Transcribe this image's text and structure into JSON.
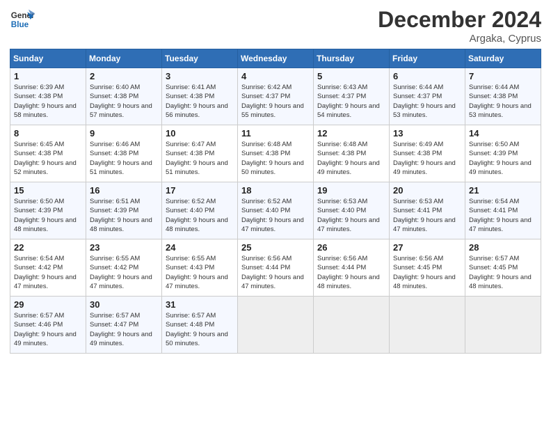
{
  "header": {
    "logo_line1": "General",
    "logo_line2": "Blue",
    "month": "December 2024",
    "location": "Argaka, Cyprus"
  },
  "weekdays": [
    "Sunday",
    "Monday",
    "Tuesday",
    "Wednesday",
    "Thursday",
    "Friday",
    "Saturday"
  ],
  "weeks": [
    [
      {
        "day": "1",
        "sunrise": "6:39 AM",
        "sunset": "4:38 PM",
        "daylight": "9 hours and 58 minutes."
      },
      {
        "day": "2",
        "sunrise": "6:40 AM",
        "sunset": "4:38 PM",
        "daylight": "9 hours and 57 minutes."
      },
      {
        "day": "3",
        "sunrise": "6:41 AM",
        "sunset": "4:38 PM",
        "daylight": "9 hours and 56 minutes."
      },
      {
        "day": "4",
        "sunrise": "6:42 AM",
        "sunset": "4:37 PM",
        "daylight": "9 hours and 55 minutes."
      },
      {
        "day": "5",
        "sunrise": "6:43 AM",
        "sunset": "4:37 PM",
        "daylight": "9 hours and 54 minutes."
      },
      {
        "day": "6",
        "sunrise": "6:44 AM",
        "sunset": "4:37 PM",
        "daylight": "9 hours and 53 minutes."
      },
      {
        "day": "7",
        "sunrise": "6:44 AM",
        "sunset": "4:38 PM",
        "daylight": "9 hours and 53 minutes."
      }
    ],
    [
      {
        "day": "8",
        "sunrise": "6:45 AM",
        "sunset": "4:38 PM",
        "daylight": "9 hours and 52 minutes."
      },
      {
        "day": "9",
        "sunrise": "6:46 AM",
        "sunset": "4:38 PM",
        "daylight": "9 hours and 51 minutes."
      },
      {
        "day": "10",
        "sunrise": "6:47 AM",
        "sunset": "4:38 PM",
        "daylight": "9 hours and 51 minutes."
      },
      {
        "day": "11",
        "sunrise": "6:48 AM",
        "sunset": "4:38 PM",
        "daylight": "9 hours and 50 minutes."
      },
      {
        "day": "12",
        "sunrise": "6:48 AM",
        "sunset": "4:38 PM",
        "daylight": "9 hours and 49 minutes."
      },
      {
        "day": "13",
        "sunrise": "6:49 AM",
        "sunset": "4:38 PM",
        "daylight": "9 hours and 49 minutes."
      },
      {
        "day": "14",
        "sunrise": "6:50 AM",
        "sunset": "4:39 PM",
        "daylight": "9 hours and 49 minutes."
      }
    ],
    [
      {
        "day": "15",
        "sunrise": "6:50 AM",
        "sunset": "4:39 PM",
        "daylight": "9 hours and 48 minutes."
      },
      {
        "day": "16",
        "sunrise": "6:51 AM",
        "sunset": "4:39 PM",
        "daylight": "9 hours and 48 minutes."
      },
      {
        "day": "17",
        "sunrise": "6:52 AM",
        "sunset": "4:40 PM",
        "daylight": "9 hours and 48 minutes."
      },
      {
        "day": "18",
        "sunrise": "6:52 AM",
        "sunset": "4:40 PM",
        "daylight": "9 hours and 47 minutes."
      },
      {
        "day": "19",
        "sunrise": "6:53 AM",
        "sunset": "4:40 PM",
        "daylight": "9 hours and 47 minutes."
      },
      {
        "day": "20",
        "sunrise": "6:53 AM",
        "sunset": "4:41 PM",
        "daylight": "9 hours and 47 minutes."
      },
      {
        "day": "21",
        "sunrise": "6:54 AM",
        "sunset": "4:41 PM",
        "daylight": "9 hours and 47 minutes."
      }
    ],
    [
      {
        "day": "22",
        "sunrise": "6:54 AM",
        "sunset": "4:42 PM",
        "daylight": "9 hours and 47 minutes."
      },
      {
        "day": "23",
        "sunrise": "6:55 AM",
        "sunset": "4:42 PM",
        "daylight": "9 hours and 47 minutes."
      },
      {
        "day": "24",
        "sunrise": "6:55 AM",
        "sunset": "4:43 PM",
        "daylight": "9 hours and 47 minutes."
      },
      {
        "day": "25",
        "sunrise": "6:56 AM",
        "sunset": "4:44 PM",
        "daylight": "9 hours and 47 minutes."
      },
      {
        "day": "26",
        "sunrise": "6:56 AM",
        "sunset": "4:44 PM",
        "daylight": "9 hours and 48 minutes."
      },
      {
        "day": "27",
        "sunrise": "6:56 AM",
        "sunset": "4:45 PM",
        "daylight": "9 hours and 48 minutes."
      },
      {
        "day": "28",
        "sunrise": "6:57 AM",
        "sunset": "4:45 PM",
        "daylight": "9 hours and 48 minutes."
      }
    ],
    [
      {
        "day": "29",
        "sunrise": "6:57 AM",
        "sunset": "4:46 PM",
        "daylight": "9 hours and 49 minutes."
      },
      {
        "day": "30",
        "sunrise": "6:57 AM",
        "sunset": "4:47 PM",
        "daylight": "9 hours and 49 minutes."
      },
      {
        "day": "31",
        "sunrise": "6:57 AM",
        "sunset": "4:48 PM",
        "daylight": "9 hours and 50 minutes."
      },
      null,
      null,
      null,
      null
    ]
  ]
}
